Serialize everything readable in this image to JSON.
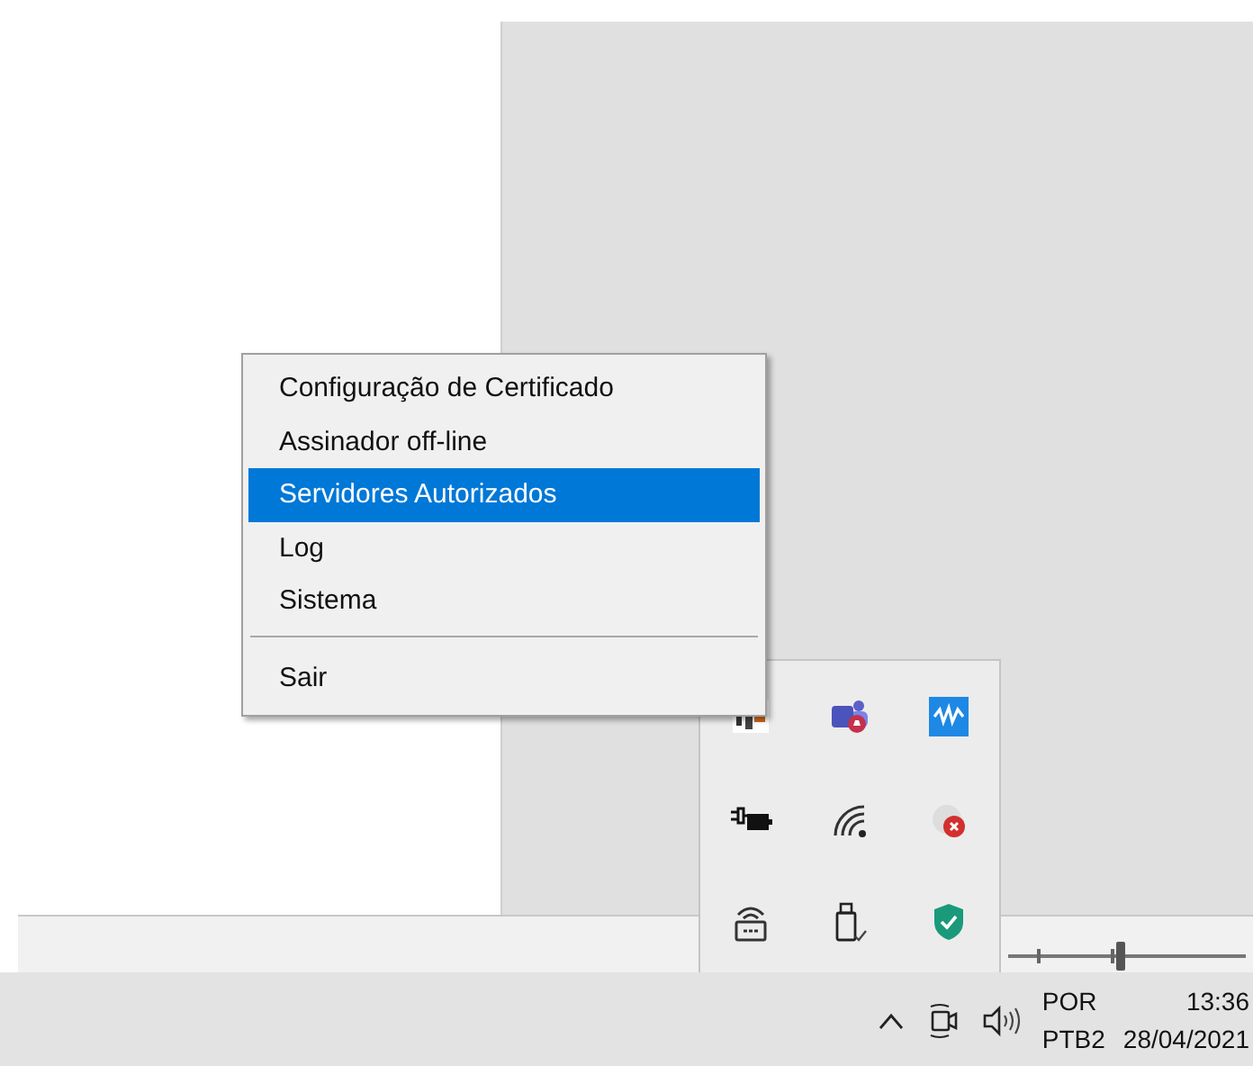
{
  "context_menu": {
    "groups": [
      [
        {
          "label": "Configuração de Certificado",
          "selected": false
        },
        {
          "label": "Assinador off-line",
          "selected": false
        },
        {
          "label": "Servidores Autorizados",
          "selected": true
        },
        {
          "label": "Log",
          "selected": false
        },
        {
          "label": "Sistema",
          "selected": false
        }
      ],
      [
        {
          "label": "Sair",
          "selected": false
        }
      ]
    ]
  },
  "background_slider": {
    "level": 0.47
  },
  "taskbar": {
    "language": "POR",
    "keyboard": "PTB2",
    "time": "13:36",
    "date": "28/04/2021"
  }
}
